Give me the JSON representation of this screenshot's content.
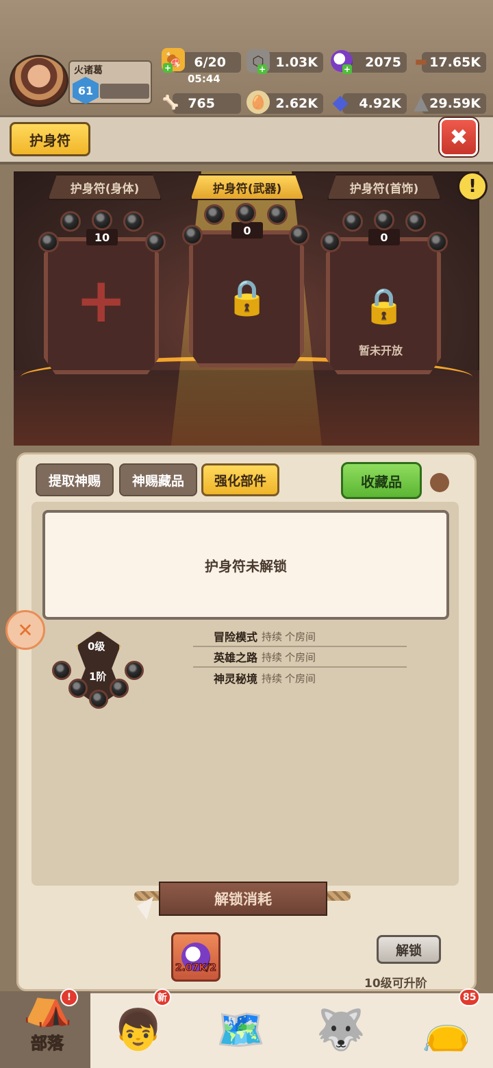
{
  "player": {
    "name": "火诸葛",
    "level": "61"
  },
  "resources": {
    "stamina": "6/20",
    "stamina_timer": "05:44",
    "iron": "1.03K",
    "orb": "2075",
    "wood": "17.65K",
    "bone": "765",
    "egg": "2.62K",
    "crystal": "4.92K",
    "stone": "29.59K"
  },
  "header": {
    "title": "护身符"
  },
  "slots": [
    {
      "label": "护身符(身体)",
      "count": "10",
      "state": "empty"
    },
    {
      "label": "护身符(武器)",
      "count": "0",
      "state": "locked"
    },
    {
      "label": "护身符(首饰)",
      "count": "0",
      "state": "locked",
      "locked_text": "暂未开放"
    }
  ],
  "tabs": {
    "extract": "提取神赐",
    "collection": "神赐藏品",
    "enhance": "强化部件",
    "favorites": "收藏品"
  },
  "notice": "护身符未解锁",
  "rank": {
    "level": "0级",
    "stage": "1阶"
  },
  "stats": [
    {
      "mode": "冒险模式",
      "pre": "持续",
      "value": "",
      "post": "个房间"
    },
    {
      "mode": "英雄之路",
      "pre": "持续",
      "value": "",
      "post": "个房间"
    },
    {
      "mode": "神灵秘境",
      "pre": "持续",
      "value": "",
      "post": "个房间"
    }
  ],
  "cost": {
    "title": "解锁消耗",
    "amount": "2.07K/2"
  },
  "unlock": {
    "button": "解锁",
    "note": "10级可升阶"
  },
  "nav": {
    "tribe": "部落",
    "new_badge": "新",
    "bag_count": "85"
  }
}
